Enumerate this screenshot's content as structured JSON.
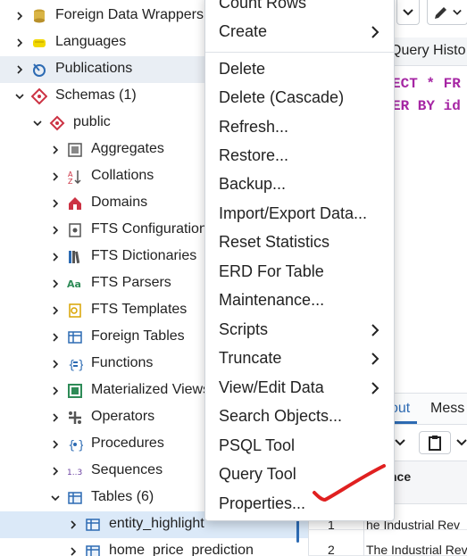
{
  "tree": {
    "items": [
      {
        "label": "Foreign Data Wrappers",
        "icon": "foreign-data-wrapper-icon",
        "expanded": false
      },
      {
        "label": "Languages",
        "icon": "language-icon",
        "expanded": false
      },
      {
        "label": "Publications",
        "icon": "publication-icon",
        "expanded": false
      },
      {
        "label": "Schemas (1)",
        "icon": "schemas-icon",
        "expanded": true
      },
      {
        "label": "public",
        "icon": "schema-icon",
        "expanded": true
      },
      {
        "label": "Aggregates",
        "icon": "aggregate-icon",
        "expanded": false
      },
      {
        "label": "Collations",
        "icon": "collation-icon",
        "expanded": false
      },
      {
        "label": "Domains",
        "icon": "domain-icon",
        "expanded": false
      },
      {
        "label": "FTS Configurations",
        "icon": "fts-configuration-icon",
        "expanded": false
      },
      {
        "label": "FTS Dictionaries",
        "icon": "fts-dictionary-icon",
        "expanded": false
      },
      {
        "label": "FTS Parsers",
        "icon": "fts-parser-icon",
        "expanded": false
      },
      {
        "label": "FTS Templates",
        "icon": "fts-template-icon",
        "expanded": false
      },
      {
        "label": "Foreign Tables",
        "icon": "foreign-table-icon",
        "expanded": false
      },
      {
        "label": "Functions",
        "icon": "function-icon",
        "expanded": false
      },
      {
        "label": "Materialized Views",
        "icon": "materialized-view-icon",
        "expanded": false
      },
      {
        "label": "Operators",
        "icon": "operator-icon",
        "expanded": false
      },
      {
        "label": "Procedures",
        "icon": "procedure-icon",
        "expanded": false
      },
      {
        "label": "Sequences",
        "icon": "sequence-icon",
        "expanded": false
      },
      {
        "label": "Tables (6)",
        "icon": "tables-icon",
        "expanded": true
      },
      {
        "label": "entity_highlight",
        "icon": "table-icon",
        "expanded": false,
        "selected": true
      },
      {
        "label": "home_price_prediction",
        "icon": "table-icon",
        "expanded": false
      }
    ]
  },
  "query_tool": {
    "history_tab": "Query Histo",
    "code_line1_kw": "ECT",
    "code_line1_rest": "* FR",
    "code_line2_kw": "ER BY",
    "code_line2_rest": "id",
    "output_tab": "out",
    "messages_tab": "Mess",
    "column_header": "nce",
    "rows": [
      {
        "num": "1",
        "value": "he Industrial Rev"
      },
      {
        "num": "2",
        "value": "The Industrial Rev"
      }
    ]
  },
  "context_menu": {
    "items": [
      {
        "label": "Count Rows",
        "submenu": false
      },
      {
        "label": "Create",
        "submenu": true
      },
      {
        "label": "Delete",
        "submenu": false
      },
      {
        "label": "Delete (Cascade)",
        "submenu": false
      },
      {
        "label": "Refresh...",
        "submenu": false
      },
      {
        "label": "Restore...",
        "submenu": false
      },
      {
        "label": "Backup...",
        "submenu": false
      },
      {
        "label": "Import/Export Data...",
        "submenu": false
      },
      {
        "label": "Reset Statistics",
        "submenu": false
      },
      {
        "label": "ERD For Table",
        "submenu": false
      },
      {
        "label": "Maintenance...",
        "submenu": false
      },
      {
        "label": "Scripts",
        "submenu": true
      },
      {
        "label": "Truncate",
        "submenu": true
      },
      {
        "label": "View/Edit Data",
        "submenu": true
      },
      {
        "label": "Search Objects...",
        "submenu": false
      },
      {
        "label": "PSQL Tool",
        "submenu": false
      },
      {
        "label": "Query Tool",
        "submenu": false
      },
      {
        "label": "Properties...",
        "submenu": false
      }
    ]
  },
  "colors": {
    "accent": "#2d6bb3",
    "keyword": "#a626a4",
    "checkmark": "#e02020",
    "selected_row": "#dbe9f8",
    "hover_row": "#e9eef4"
  }
}
